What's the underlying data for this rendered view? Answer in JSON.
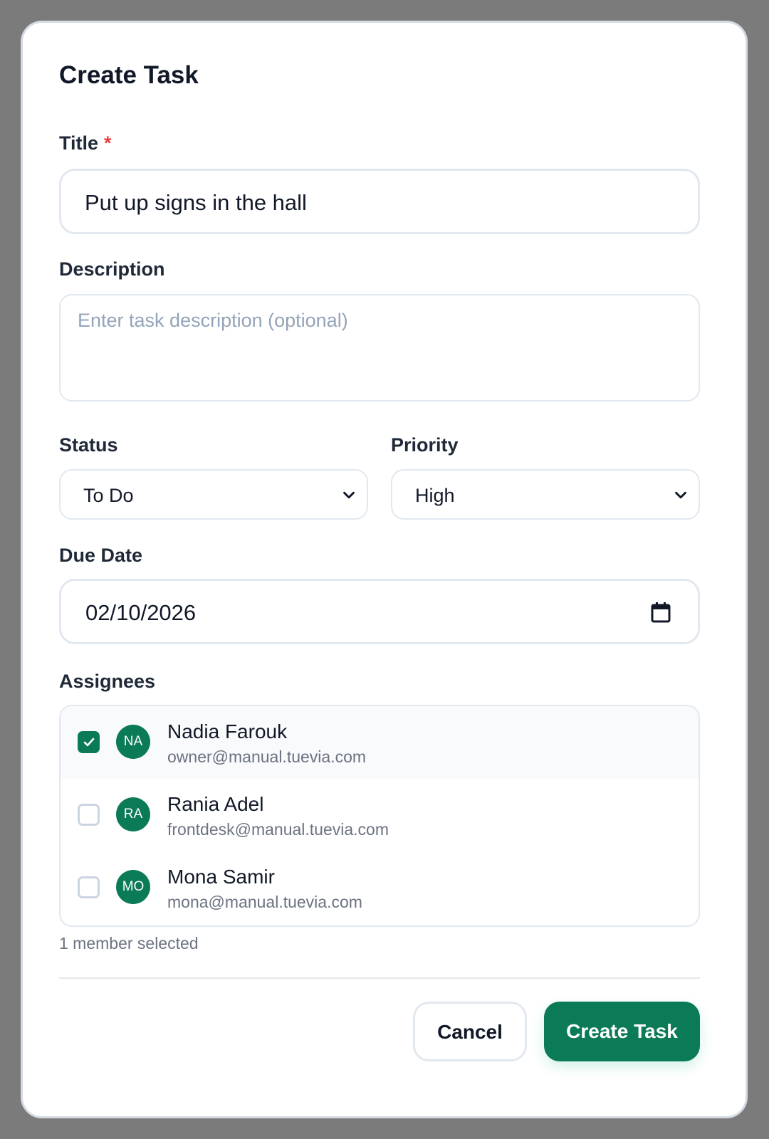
{
  "dialog": {
    "title": "Create Task",
    "fields": {
      "title": {
        "label": "Title",
        "required_mark": "*",
        "value": "Put up signs in the hall"
      },
      "description": {
        "label": "Description",
        "value": "",
        "placeholder": "Enter task description (optional)"
      },
      "status": {
        "label": "Status",
        "value": "To Do"
      },
      "priority": {
        "label": "Priority",
        "value": "High"
      },
      "due_date": {
        "label": "Due Date",
        "value": "02/10/2026"
      }
    },
    "assignees": {
      "label": "Assignees",
      "members": [
        {
          "initials": "NA",
          "name": "Nadia Farouk",
          "email": "owner@manual.tuevia.com",
          "checked": true
        },
        {
          "initials": "RA",
          "name": "Rania Adel",
          "email": "frontdesk@manual.tuevia.com",
          "checked": false
        },
        {
          "initials": "MO",
          "name": "Mona Samir",
          "email": "mona@manual.tuevia.com",
          "checked": false
        }
      ],
      "selection_summary": "1 member selected"
    },
    "actions": {
      "cancel": "Cancel",
      "create": "Create Task"
    }
  },
  "theme": {
    "accent": "#0b7a57",
    "required": "#e53e3e",
    "backdrop": "#7b7b7b"
  },
  "icons": {
    "select_chevron": "chevron-down-icon",
    "date_picker": "calendar-icon",
    "check": "checkmark-icon"
  }
}
